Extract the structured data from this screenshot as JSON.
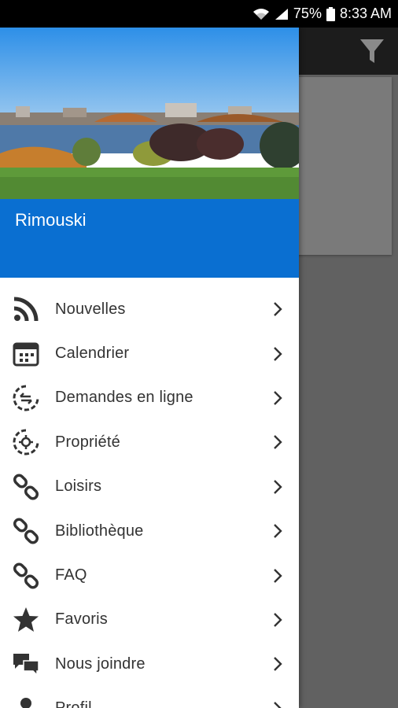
{
  "status_bar": {
    "battery": "75%",
    "time": "8:33 AM",
    "icons": [
      "wifi-icon",
      "signal-icon",
      "battery-icon"
    ]
  },
  "app_bar": {
    "filter_icon": "filter-icon"
  },
  "drawer": {
    "city": "Rimouski",
    "accent_color": "#0a6fd1",
    "items": [
      {
        "label": "Nouvelles",
        "icon": "rss-icon"
      },
      {
        "label": "Calendrier",
        "icon": "calendar-icon"
      },
      {
        "label": "Demandes en ligne",
        "icon": "online-requests-icon"
      },
      {
        "label": "Propriété",
        "icon": "property-icon"
      },
      {
        "label": "Loisirs",
        "icon": "link-icon"
      },
      {
        "label": "Bibliothèque",
        "icon": "link-icon"
      },
      {
        "label": "FAQ",
        "icon": "link-icon"
      },
      {
        "label": "Favoris",
        "icon": "star-icon"
      },
      {
        "label": "Nous joindre",
        "icon": "chat-icon"
      },
      {
        "label": "Profil",
        "icon": "profile-icon"
      }
    ]
  }
}
